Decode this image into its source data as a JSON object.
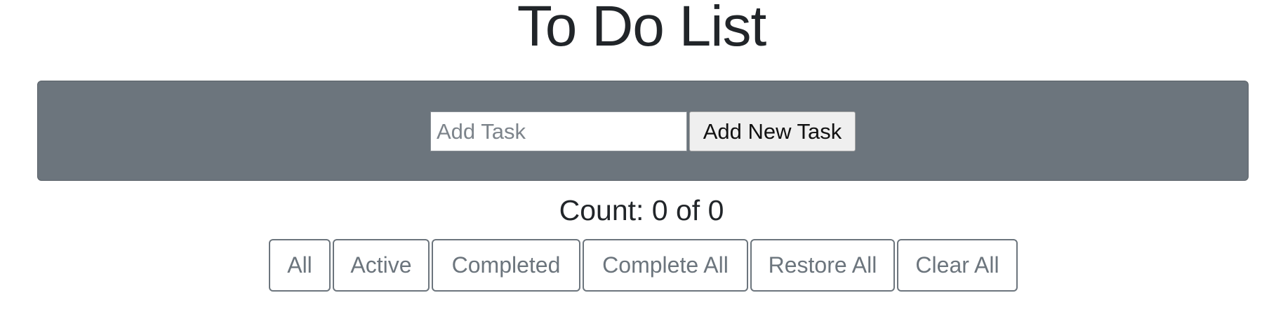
{
  "header": {
    "title": "To Do List"
  },
  "add_task": {
    "input_value": "",
    "input_placeholder": "Add Task",
    "button_label": "Add New Task"
  },
  "counter": {
    "text": "Count: 0 of 0"
  },
  "filters": {
    "all": "All",
    "active": "Active",
    "completed": "Completed",
    "complete_all": "Complete All",
    "restore_all": "Restore All",
    "clear_all": "Clear All"
  },
  "colors": {
    "panel": "#6c757d",
    "text": "#212529",
    "outline_button": "#6c757d"
  }
}
